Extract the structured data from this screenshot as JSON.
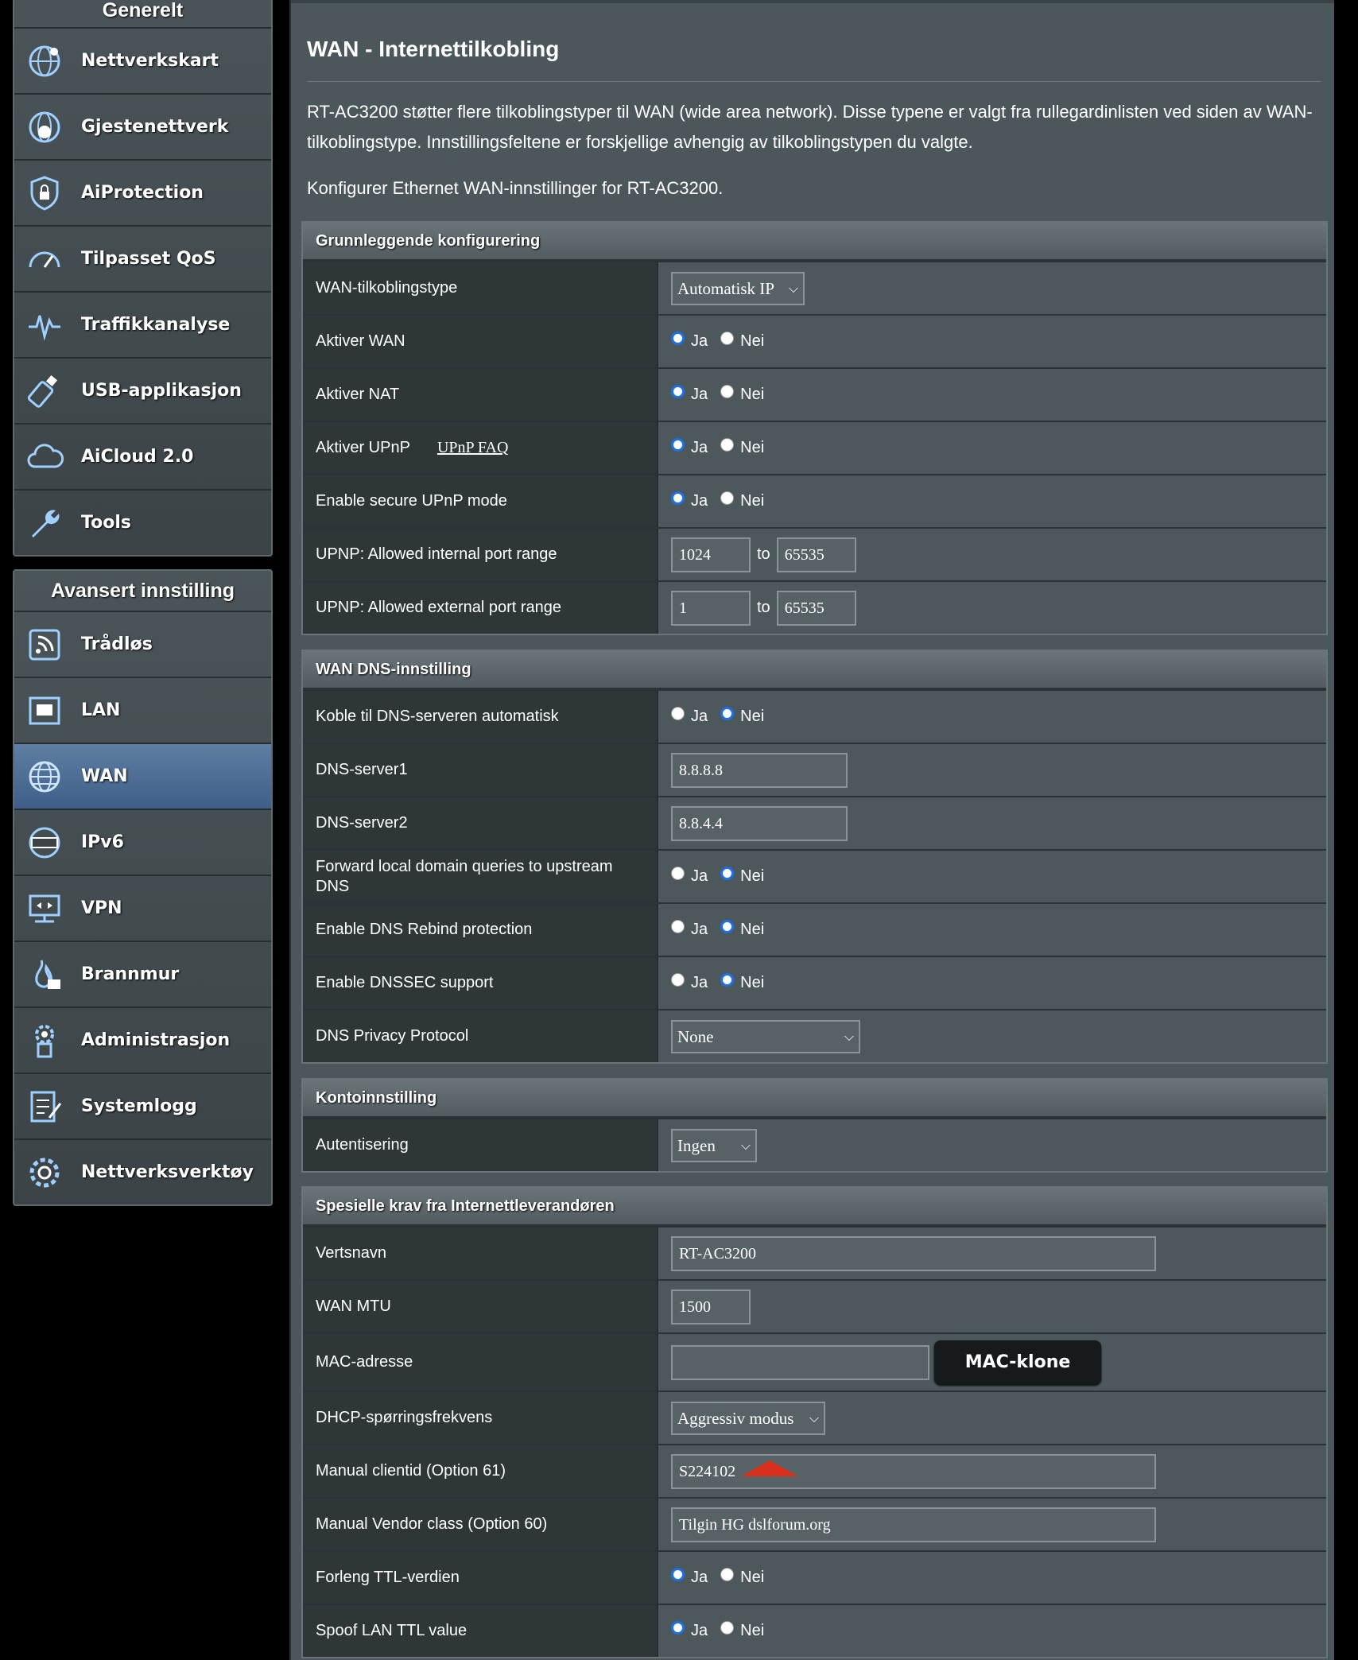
{
  "sidebar": {
    "general": {
      "title": "Generelt",
      "items": [
        {
          "label": "Nettverkskart",
          "icon": "network-map-icon"
        },
        {
          "label": "Gjestenettverk",
          "icon": "guest-network-icon"
        },
        {
          "label": "AiProtection",
          "icon": "aiprotection-icon"
        },
        {
          "label": "Tilpasset QoS",
          "icon": "qos-gauge-icon"
        },
        {
          "label": "Traffikkanalyse",
          "icon": "traffic-analyzer-icon"
        },
        {
          "label": "USB-applikasjon",
          "icon": "usb-icon"
        },
        {
          "label": "AiCloud 2.0",
          "icon": "cloud-icon"
        },
        {
          "label": "Tools",
          "icon": "wrench-icon"
        }
      ]
    },
    "advanced": {
      "title": "Avansert innstilling",
      "items": [
        {
          "label": "Trådløs",
          "icon": "wireless-icon"
        },
        {
          "label": "LAN",
          "icon": "lan-icon"
        },
        {
          "label": "WAN",
          "icon": "globe-icon",
          "active": true
        },
        {
          "label": "IPv6",
          "icon": "ipv6-icon"
        },
        {
          "label": "VPN",
          "icon": "vpn-icon"
        },
        {
          "label": "Brannmur",
          "icon": "firewall-icon"
        },
        {
          "label": "Administrasjon",
          "icon": "admin-icon"
        },
        {
          "label": "Systemlogg",
          "icon": "system-log-icon"
        },
        {
          "label": "Nettverksverktøy",
          "icon": "network-tools-icon"
        }
      ]
    }
  },
  "main": {
    "title": "WAN - Internettilkobling",
    "description": "RT-AC3200 støtter flere tilkoblingstyper til WAN (wide area network). Disse typene er valgt fra rullegardinlisten ved siden av WAN-tilkoblingstype. Innstillingsfeltene er forskjellige avhengig av tilkoblingstypen du valgte.",
    "description2": "Konfigurer Ethernet WAN-innstillinger for RT-AC3200.",
    "radio_yes": "Ja",
    "radio_no": "Nei",
    "to_label": "to",
    "basic": {
      "title": "Grunnleggende konfigurering",
      "wan_type": {
        "label": "WAN-tilkoblingstype",
        "value": "Automatisk IP"
      },
      "enable_wan": {
        "label": "Aktiver WAN",
        "value": "Ja"
      },
      "enable_nat": {
        "label": "Aktiver NAT",
        "value": "Ja"
      },
      "enable_upnp": {
        "label": "Aktiver UPnP",
        "link": "UPnP FAQ",
        "value": "Ja"
      },
      "secure_upnp": {
        "label": "Enable secure UPnP mode",
        "value": "Ja"
      },
      "upnp_internal": {
        "label": "UPNP: Allowed internal port range",
        "from": "1024",
        "to": "65535"
      },
      "upnp_external": {
        "label": "UPNP: Allowed external port range",
        "from": "1",
        "to": "65535"
      }
    },
    "dns": {
      "title": "WAN DNS-innstilling",
      "auto_dns": {
        "label": "Koble til DNS-serveren automatisk",
        "value": "Nei"
      },
      "dns1": {
        "label": "DNS-server1",
        "value": "8.8.8.8"
      },
      "dns2": {
        "label": "DNS-server2",
        "value": "8.8.4.4"
      },
      "forward_local": {
        "label": "Forward local domain queries to upstream DNS",
        "value": "Nei"
      },
      "rebind": {
        "label": "Enable DNS Rebind protection",
        "value": "Nei"
      },
      "dnssec": {
        "label": "Enable DNSSEC support",
        "value": "Nei"
      },
      "privacy": {
        "label": "DNS Privacy Protocol",
        "value": "None"
      }
    },
    "account": {
      "title": "Kontoinnstilling",
      "auth": {
        "label": "Autentisering",
        "value": "Ingen"
      }
    },
    "isp": {
      "title": "Spesielle krav fra Internettleverandøren",
      "hostname": {
        "label": "Vertsnavn",
        "value": "RT-AC3200"
      },
      "mtu": {
        "label": "WAN MTU",
        "value": "1500"
      },
      "mac": {
        "label": "MAC-adresse",
        "value": "",
        "button": "MAC-klone"
      },
      "dhcp_freq": {
        "label": "DHCP-spørringsfrekvens",
        "value": "Aggressiv modus"
      },
      "clientid": {
        "label": "Manual clientid (Option 61)",
        "value": "S224102"
      },
      "vendor": {
        "label": "Manual Vendor class (Option 60)",
        "value": "Tilgin HG dslforum.org"
      },
      "ttl": {
        "label": "Forleng TTL-verdien",
        "value": "Ja"
      },
      "spoof_ttl": {
        "label": "Spoof LAN TTL value",
        "value": "Ja"
      }
    }
  }
}
